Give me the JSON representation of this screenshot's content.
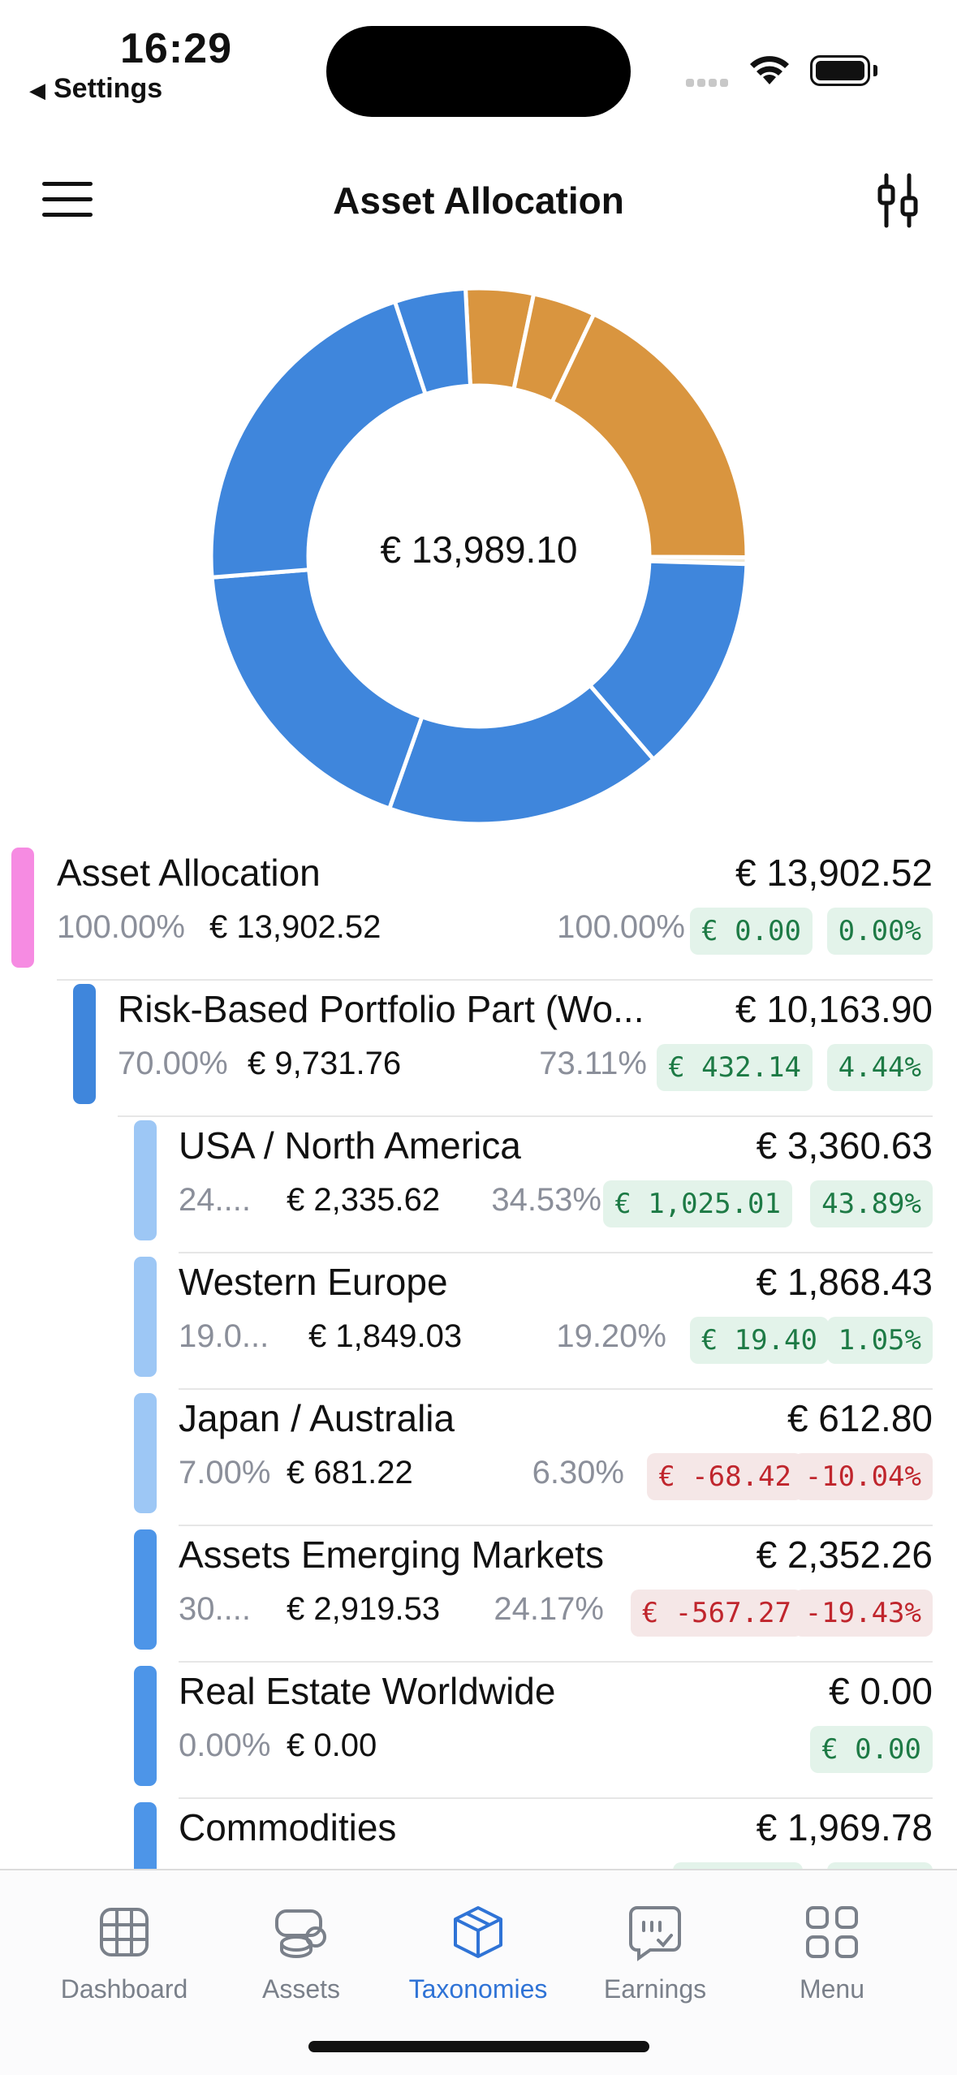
{
  "status_bar": {
    "time": "16:29",
    "back_label": "Settings"
  },
  "header": {
    "title": "Asset Allocation"
  },
  "chart_data": {
    "type": "pie",
    "center_label": "€ 13,989.10",
    "slices": [
      {
        "value": 4.1,
        "color": "#d9953f"
      },
      {
        "value": 3.8,
        "color": "#d9953f"
      },
      {
        "value": 18.1,
        "color": "#d9953f"
      },
      {
        "value": 0.4,
        "color": "#f0e9d8"
      },
      {
        "value": 13.3,
        "color": "#3f86dc"
      },
      {
        "value": 16.8,
        "color": "#3f86dc"
      },
      {
        "value": 18.4,
        "color": "#3f86dc"
      },
      {
        "value": 21.3,
        "color": "#3f86dc"
      },
      {
        "value": 4.3,
        "color": "#3f86dc"
      }
    ]
  },
  "rows": [
    {
      "name": "Asset Allocation",
      "value": "€ 13,902.52",
      "target_pct": "100.00%",
      "target_amt": "€ 13,902.52",
      "actual_pct": "100.00%",
      "delta_amt": "€ 0.00",
      "delta_pct": "0.00%",
      "bar_color": "#f68be2"
    },
    {
      "name": "Risk-Based Portfolio Part (Wo...",
      "value": "€ 10,163.90",
      "target_pct": "70.00%",
      "target_amt": "€ 9,731.76",
      "actual_pct": "73.11%",
      "delta_amt": "€ 432.14",
      "delta_pct": "4.44%",
      "bar_color": "#3f86dc"
    },
    {
      "name": "USA / North America",
      "value": "€ 3,360.63",
      "target_pct": "24....",
      "target_amt": "€ 2,335.62",
      "actual_pct": "34.53%",
      "delta_amt": "€ 1,025.01",
      "delta_pct": "43.89%",
      "bar_color": "#9dc7f5"
    },
    {
      "name": "Western Europe",
      "value": "€ 1,868.43",
      "target_pct": "19.0...",
      "target_amt": "€ 1,849.03",
      "actual_pct": "19.20%",
      "delta_amt": "€ 19.40",
      "delta_pct": "1.05%",
      "bar_color": "#9dc7f5"
    },
    {
      "name": "Japan / Australia",
      "value": "€ 612.80",
      "target_pct": "7.00%",
      "target_amt": "€ 681.22",
      "actual_pct": "6.30%",
      "delta_amt": "€ -68.42",
      "delta_pct": "-10.04%",
      "bar_color": "#9dc7f5"
    },
    {
      "name": "Assets Emerging Markets",
      "value": "€ 2,352.26",
      "target_pct": "30....",
      "target_amt": "€ 2,919.53",
      "actual_pct": "24.17%",
      "delta_amt": "€ -567.27",
      "delta_pct": "-19.43%",
      "bar_color": "#4d95e8"
    },
    {
      "name": "Real Estate Worldwide",
      "value": "€ 0.00",
      "target_pct": "0.00%",
      "target_amt": "€ 0.00",
      "delta_amt": "€ 0.00",
      "bar_color": "#4d95e8"
    },
    {
      "name": "Commodities",
      "value": "€ 1,969.78",
      "bar_color": "#4d95e8"
    }
  ],
  "tabs": [
    {
      "label": "Dashboard",
      "icon": "grid-icon"
    },
    {
      "label": "Assets",
      "icon": "coins-icon"
    },
    {
      "label": "Taxonomies",
      "icon": "cube-icon"
    },
    {
      "label": "Earnings",
      "icon": "earnings-chat-icon"
    },
    {
      "label": "Menu",
      "icon": "apps-grid-icon"
    }
  ],
  "active_tab": "Taxonomies",
  "colors": {
    "accent": "#2f73d6",
    "positive": "#1d7a45",
    "negative": "#c0262d"
  }
}
